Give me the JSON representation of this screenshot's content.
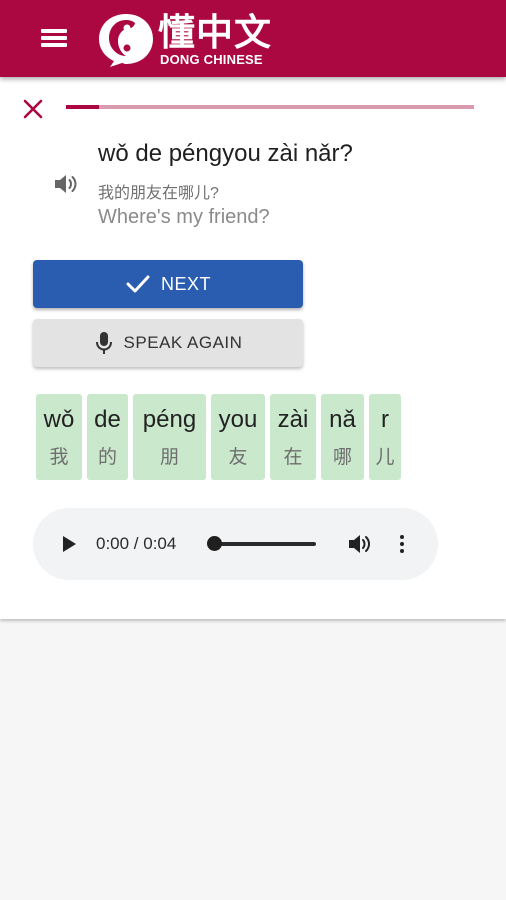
{
  "app": {
    "logo_chinese": "懂中文",
    "logo_english": "DONG CHINESE",
    "brand_color": "#ab0740"
  },
  "lesson": {
    "progress": 0.08,
    "pinyin": "wǒ de péngyou zài nǎr?",
    "hanzi": "我的朋友在哪儿?",
    "english": "Where's my friend?"
  },
  "buttons": {
    "next_label": "NEXT",
    "speak_again_label": "SPEAK AGAIN"
  },
  "words": [
    {
      "pinyin": "wǒ",
      "hanzi": "我"
    },
    {
      "pinyin": "de",
      "hanzi": "的"
    },
    {
      "pinyin": "péng",
      "hanzi": "朋"
    },
    {
      "pinyin": "you",
      "hanzi": "友"
    },
    {
      "pinyin": "zài",
      "hanzi": "在"
    },
    {
      "pinyin": "nǎ",
      "hanzi": "哪"
    },
    {
      "pinyin": "r",
      "hanzi": "儿"
    }
  ],
  "audio": {
    "time_display": "0:00 / 0:04",
    "position": 0.0
  },
  "icons": [
    "menu-icon",
    "logo-icon",
    "close-icon",
    "speaker-icon",
    "check-icon",
    "microphone-icon",
    "play-icon",
    "volume-icon",
    "more-vert-icon"
  ]
}
